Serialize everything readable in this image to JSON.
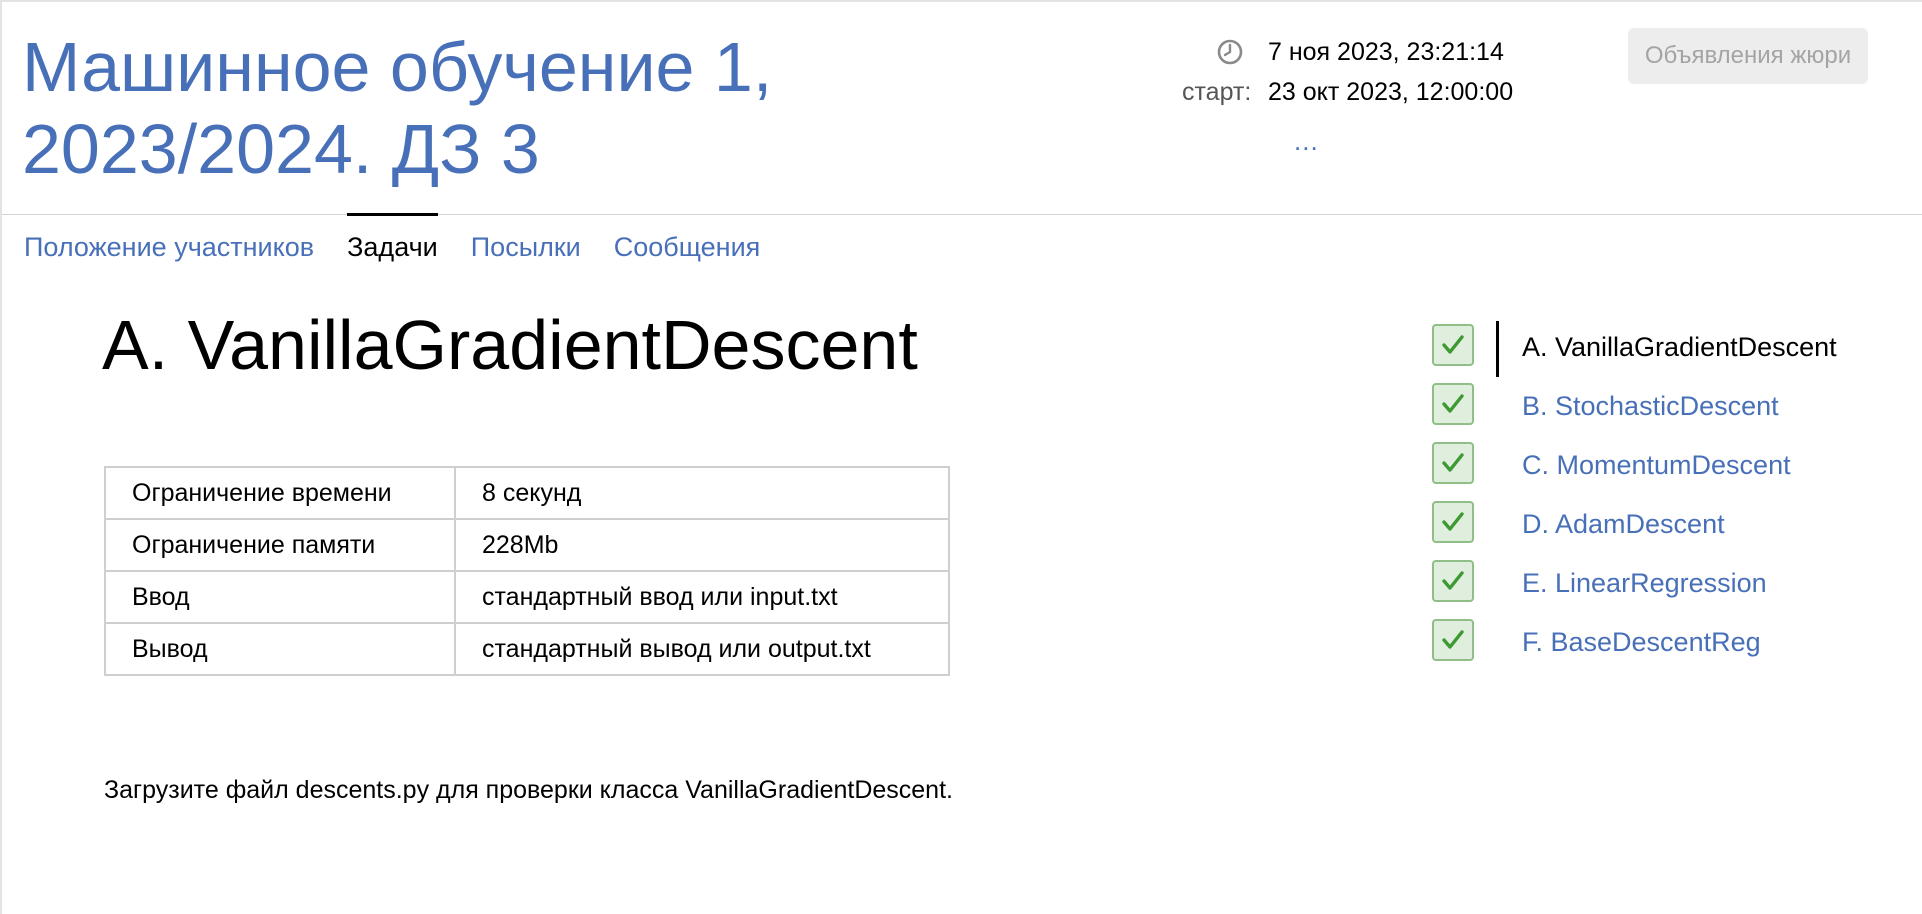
{
  "header": {
    "title": "Машинное обучение 1, 2023/2024. ДЗ 3",
    "current_time": "7 ноя 2023, 23:21:14",
    "start_label": "старт:",
    "start_time": "23 окт 2023, 12:00:00",
    "more_label": "...",
    "jury_button": "Объявления жюри"
  },
  "tabs": [
    {
      "label": "Положение участников",
      "active": false
    },
    {
      "label": "Задачи",
      "active": true
    },
    {
      "label": "Посылки",
      "active": false
    },
    {
      "label": "Сообщения",
      "active": false
    }
  ],
  "problem": {
    "title": "A. VanillaGradientDescent",
    "limits": [
      {
        "label": "Ограничение времени",
        "value": "8 секунд"
      },
      {
        "label": "Ограничение памяти",
        "value": "228Mb"
      },
      {
        "label": "Ввод",
        "value": "стандартный ввод или input.txt"
      },
      {
        "label": "Вывод",
        "value": "стандартный вывод или output.txt"
      }
    ],
    "statement": "Загрузите файл descents.py для проверки класса VanillaGradientDescent."
  },
  "problem_list": [
    {
      "label": "A. VanillaGradientDescent",
      "status": "solved",
      "active": true
    },
    {
      "label": "B. StochasticDescent",
      "status": "solved",
      "active": false
    },
    {
      "label": "C. MomentumDescent",
      "status": "solved",
      "active": false
    },
    {
      "label": "D. AdamDescent",
      "status": "solved",
      "active": false
    },
    {
      "label": "E. LinearRegression",
      "status": "solved",
      "active": false
    },
    {
      "label": "F. BaseDescentReg",
      "status": "solved",
      "active": false
    }
  ],
  "colors": {
    "link": "#4870b8",
    "check": "#3d9a32",
    "check_bg": "#dfeedd",
    "check_border": "#8fbf86"
  },
  "icons": {
    "clock": "clock-icon",
    "solved": "checkmark-icon"
  }
}
